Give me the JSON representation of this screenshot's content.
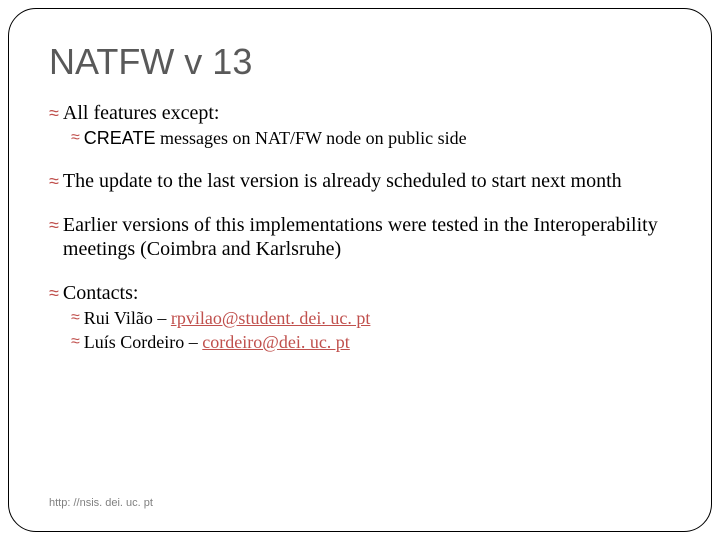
{
  "title": "NATFW v 13",
  "bullets": {
    "b1": "All features except:",
    "b1_sub1_caps": "CREATE",
    "b1_sub1_rest": " messages on NAT/FW node on public side",
    "b2": "The update to the last version is already scheduled to start next month",
    "b3": "Earlier versions of this implementations were tested in the Interoperability meetings (Coimbra and Karlsruhe)",
    "b4": "Contacts:",
    "b4_sub1_name": "Rui Vilão – ",
    "b4_sub1_link": "rpvilao@student. dei. uc. pt",
    "b4_sub2_name": "Luís Cordeiro – ",
    "b4_sub2_link": "cordeiro@dei. uc. pt"
  },
  "footer": "http: //nsis. dei. uc. pt",
  "glyph": "≈"
}
